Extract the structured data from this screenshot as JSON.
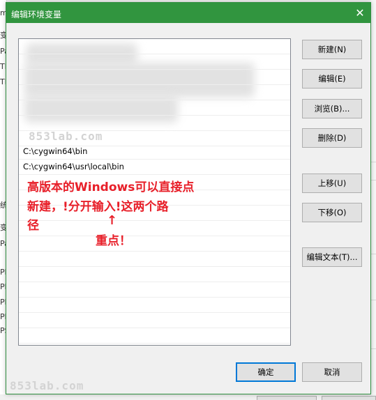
{
  "dialog": {
    "title": "编辑环境变量",
    "close_glyph": "✕"
  },
  "list": {
    "items": [
      "C:\\cygwin64\\bin",
      "C:\\cygwin64\\usr\\local\\bin"
    ]
  },
  "buttons": {
    "new": "新建(N)",
    "edit": "编辑(E)",
    "browse": "浏览(B)...",
    "delete": "删除(D)",
    "move_up": "上移(U)",
    "move_down": "下移(O)",
    "edit_text": "编辑文本(T)...",
    "ok": "确定",
    "cancel": "取消"
  },
  "annotation": {
    "line1": "高版本的Windows可以直接点",
    "line2": "新建，!分开输入!这两个路",
    "line3": "径",
    "arrow": "↑",
    "emphasis": "重点！"
  },
  "watermark": {
    "text": "853lab.com"
  },
  "background_window": {
    "letters": [
      "m",
      "变",
      "Pa",
      "TE",
      "TM",
      "统",
      "变",
      "Pa",
      "PF",
      "PF",
      "PF",
      "PF",
      "PS"
    ]
  },
  "colors": {
    "titlebar": "#31953f",
    "annotation": "#e8202a",
    "default_button_border": "#0078d7"
  }
}
